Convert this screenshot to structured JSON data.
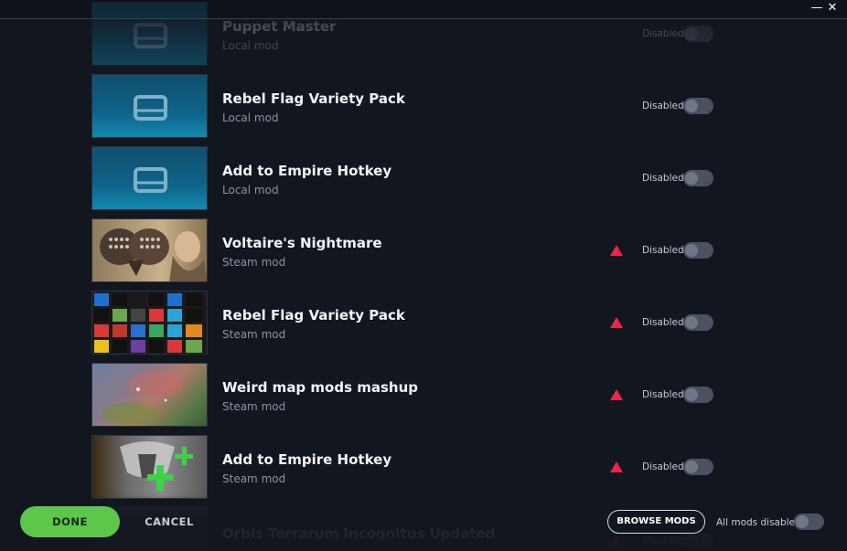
{
  "window": {
    "minimize_glyph": "—",
    "close_glyph": "✕"
  },
  "mods": [
    {
      "name": "Puppet Master",
      "source": "Local mod",
      "state": "Disabled",
      "enabled": false,
      "warning": false,
      "thumb": "local-drive",
      "faded": true
    },
    {
      "name": "Rebel Flag Variety Pack",
      "source": "Local mod",
      "state": "Disabled",
      "enabled": false,
      "warning": false,
      "thumb": "local-drive"
    },
    {
      "name": "Add to Empire Hotkey",
      "source": "Local mod",
      "state": "Disabled",
      "enabled": false,
      "warning": false,
      "thumb": "local-drive"
    },
    {
      "name": "Voltaire's Nightmare",
      "source": "Steam mod",
      "state": "Disabled",
      "enabled": false,
      "warning": true,
      "thumb": "voltaire-portrait"
    },
    {
      "name": "Rebel Flag Variety Pack",
      "source": "Steam mod",
      "state": "Disabled",
      "enabled": false,
      "warning": true,
      "thumb": "flag-grid"
    },
    {
      "name": "Weird map mods mashup",
      "source": "Steam mod",
      "state": "Disabled",
      "enabled": false,
      "warning": true,
      "thumb": "galaxy-map"
    },
    {
      "name": "Add to Empire Hotkey",
      "source": "Steam mod",
      "state": "Disabled",
      "enabled": false,
      "warning": true,
      "thumb": "eagle-plus"
    },
    {
      "name": "Orbis Terrarum Incognitus Updated",
      "source": "",
      "state": "Disabled",
      "enabled": false,
      "warning": true,
      "thumb": "other",
      "faded": true
    }
  ],
  "footer": {
    "done_label": "DONE",
    "cancel_label": "CANCEL",
    "browse_label": "BROWSE MODS",
    "all_mods_label": "All mods disabled",
    "all_mods_enabled": false
  },
  "colors": {
    "background": "#12161f",
    "done_button": "#5ec64a",
    "warning": "#e8264a",
    "toggle_off": "#4b5160",
    "local_thumb": "#0f6288"
  },
  "icons": {
    "warning": "warning-triangle-icon",
    "local_thumb": "drive-icon"
  }
}
